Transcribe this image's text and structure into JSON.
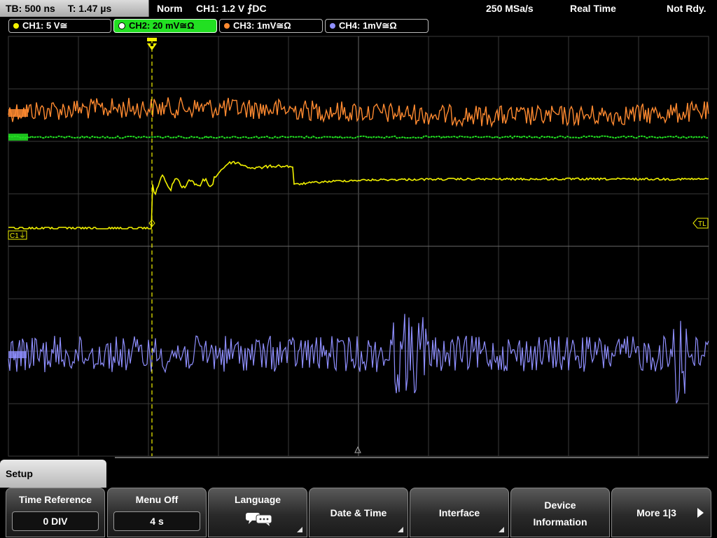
{
  "status": {
    "timebase": "TB: 500 ns",
    "trigger_time": "T: 1.47 µs",
    "mode": "Norm",
    "trigger": "CH1: 1.2 V ⨍DC",
    "sample_rate": "250 MSa/s",
    "acq_mode": "Real Time",
    "ready": "Not Rdy."
  },
  "channels": [
    {
      "label": "CH1: 5 V≅",
      "color": "#f2f200",
      "active": false
    },
    {
      "label": "CH2: 20 mV≅Ω",
      "color": "#22e022",
      "active": true
    },
    {
      "label": "CH3: 1mV≅Ω",
      "color": "#ff8a30",
      "active": false
    },
    {
      "label": "CH4: 1mV≅Ω",
      "color": "#8f8fff",
      "active": false
    }
  ],
  "markers": {
    "ch1": "C1",
    "trigger_level": "TL"
  },
  "colors": {
    "ch1": "#f2f200",
    "ch2": "#22e022",
    "ch3": "#ff8a30",
    "ch4": "#8f8fff",
    "grid": "#3a3a3a",
    "grid_center": "#6a6a6a"
  },
  "menu": {
    "title": "Setup",
    "keys": {
      "time_reference": {
        "label": "Time Reference",
        "value": "0 DIV"
      },
      "menu_off": {
        "label": "Menu Off",
        "value": "4 s"
      },
      "language": {
        "label": "Language",
        "icon": "speech-bubbles-icon"
      },
      "date_time": {
        "label": "Date & Time"
      },
      "interface": {
        "label": "Interface"
      },
      "device_info": {
        "line1": "Device",
        "line2": "Information"
      },
      "more": {
        "label": "More 1|3"
      }
    }
  }
}
